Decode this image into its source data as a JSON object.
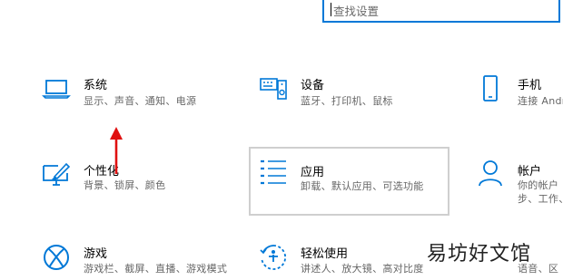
{
  "search": {
    "placeholder": "查找设置"
  },
  "tiles": [
    {
      "title": "系统",
      "desc": "显示、声音、通知、电源"
    },
    {
      "title": "设备",
      "desc": "蓝牙、打印机、鼠标"
    },
    {
      "title": "手机",
      "desc": "连接 Andr"
    },
    {
      "title": "个性化",
      "desc": "背景、锁屏、颜色"
    },
    {
      "title": "应用",
      "desc": "卸载、默认应用、可选功能"
    },
    {
      "title": "帐户",
      "desc_line1": "你的帐户",
      "desc_line2": "步、工作、"
    },
    {
      "title": "游戏",
      "desc": "游戏栏、截屏、直播、游戏模式"
    },
    {
      "title": "轻松使用",
      "desc": "讲述人、放大镜、高对比度"
    },
    {
      "title": "",
      "desc": "语音、区"
    }
  ],
  "watermark": "易坊好文馆",
  "colors": {
    "accent": "#0078d7",
    "arrow": "#e01010",
    "selected_border": "#cfcfcf"
  }
}
